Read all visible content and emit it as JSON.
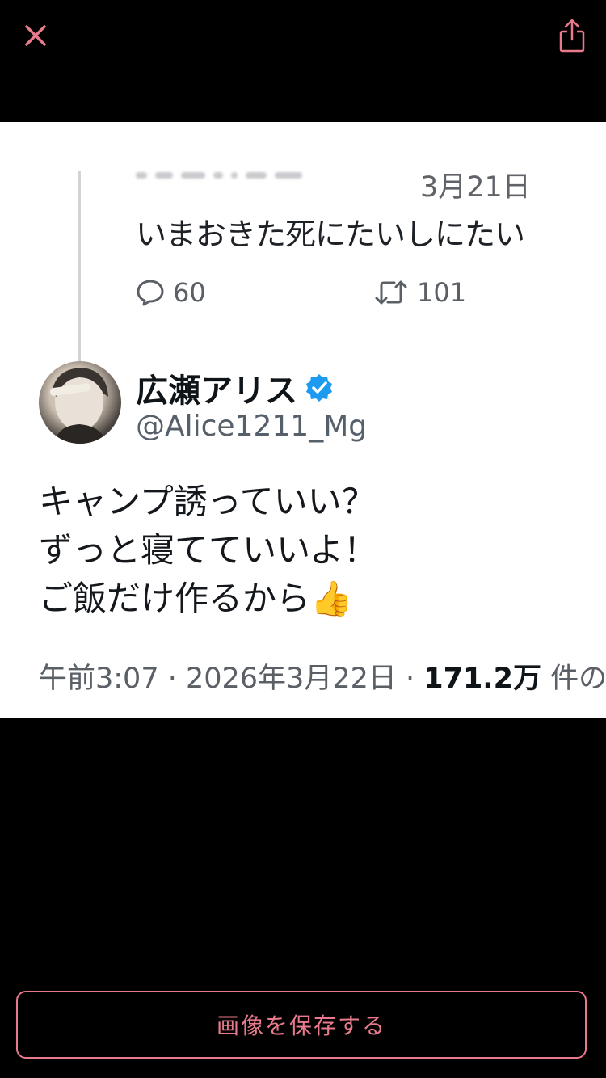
{
  "colors": {
    "accent": "#e87a8c",
    "background": "#000000",
    "verified": "#1d9bf0"
  },
  "toolbar": {
    "close_icon": "close-icon",
    "share_icon": "share-icon"
  },
  "tweet_image": {
    "previous_tweet": {
      "date": "3月21日",
      "text": "いまおきた死にたいしにたい",
      "replies": "60",
      "retweets": "101"
    },
    "author": {
      "display_name": "広瀬アリス",
      "handle": "@Alice1211_Mg",
      "verified": true
    },
    "body_lines": [
      "キャンプ誘っていい？",
      "ずっと寝てていいよ！",
      "ご飯だけ作るから👍"
    ],
    "meta": {
      "time_date": "午前3:07 · 2026年3月22日 · ",
      "views_count": "171.2万",
      "views_suffix": " 件の表示"
    }
  },
  "footer": {
    "save_label": "画像を保存する"
  }
}
